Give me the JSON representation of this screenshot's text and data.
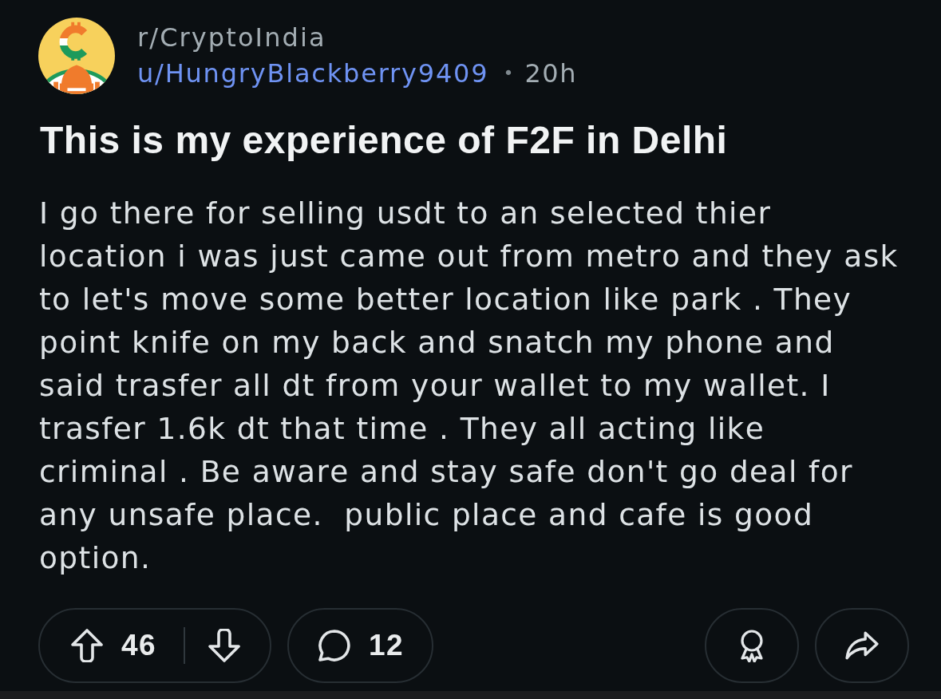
{
  "post": {
    "subreddit": "r/CryptoIndia",
    "author": "u/HungryBlackberry9409",
    "separator": "•",
    "age": "20h",
    "title": "This is my experience of F2F in Delhi",
    "body": "I go there for selling usdt to an selected thier location i was just came out from metro and they ask to let's move some better location like park . They point knife on my back and snatch my phone and said trasfer all dt from your wallet to my wallet. I trasfer 1.6k dt that time . They all acting like criminal . Be aware and stay safe don't go deal for any unsafe place.  public place and cafe is good option."
  },
  "actions": {
    "vote_count": "46",
    "comment_count": "12"
  }
}
